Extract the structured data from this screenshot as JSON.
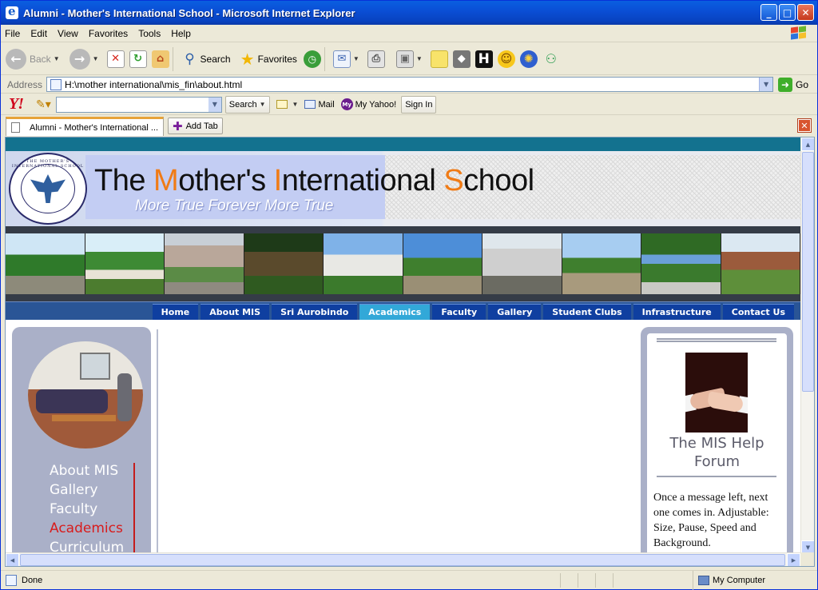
{
  "window": {
    "title": "Alumni - Mother's International School - Microsoft Internet Explorer",
    "controls": {
      "minimize": "_",
      "maximize": "□",
      "close": "✕"
    }
  },
  "menu": [
    "File",
    "Edit",
    "View",
    "Favorites",
    "Tools",
    "Help"
  ],
  "toolbar": {
    "back_label": "Back",
    "search_label": "Search",
    "favorites_label": "Favorites"
  },
  "address": {
    "label": "Address",
    "url": "H:\\mother international\\mis_fin\\about.html",
    "go_label": "Go"
  },
  "yahoo": {
    "logo": "Y!",
    "search_label": "Search",
    "mail_label": "Mail",
    "myyahoo_badge": "My",
    "myyahoo_label": "My Yahoo!",
    "signin_label": "Sign In"
  },
  "tabs": {
    "active_tab": "Alumni - Mother's International ...",
    "add_tab_label": "Add Tab"
  },
  "site": {
    "title_parts": [
      "The ",
      "M",
      "other's ",
      "I",
      "nternational ",
      "S",
      "chool"
    ],
    "tagline": "More True Forever More True",
    "seal_text": "THE MOTHER'S INTERNATIONAL SCHOOL",
    "nav": [
      {
        "label": "Home",
        "active": false
      },
      {
        "label": "About MIS",
        "active": false
      },
      {
        "label": "Sri Aurobindo",
        "active": false
      },
      {
        "label": "Academics",
        "active": true
      },
      {
        "label": "Faculty",
        "active": false
      },
      {
        "label": "Gallery",
        "active": false
      },
      {
        "label": "Student Clubs",
        "active": false
      },
      {
        "label": "Infrastructure",
        "active": false
      },
      {
        "label": "Contact Us",
        "active": false
      }
    ],
    "sidebar_links": [
      {
        "label": "About MIS",
        "active": false
      },
      {
        "label": "Gallery",
        "active": false
      },
      {
        "label": "Faculty",
        "active": false
      },
      {
        "label": "Academics",
        "active": true
      },
      {
        "label": "Curriculum",
        "active": false
      }
    ],
    "forum": {
      "title": "The MIS Help Forum",
      "text": "Once a message left, next one comes in. Adjustable: Size, Pause, Speed and Background."
    }
  },
  "status": {
    "text": "Done",
    "zone": "My Computer"
  },
  "colors": {
    "accent_orange": "#f07b16",
    "nav_blue": "#0f3fa0",
    "nav_active": "#32a8d8",
    "sidebar_active": "#d81c1c",
    "teal_strip": "#13728f"
  }
}
